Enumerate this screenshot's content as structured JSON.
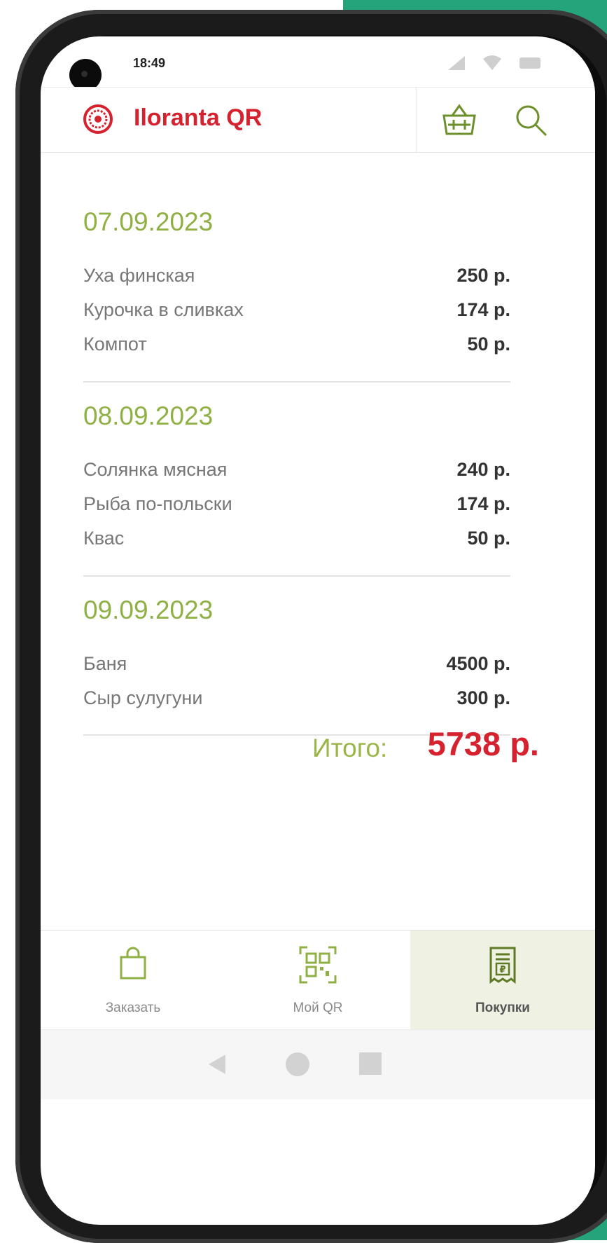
{
  "status_bar": {
    "time": "18:49"
  },
  "app_bar": {
    "title": "Iloranta QR"
  },
  "purchases": [
    {
      "date": "07.09.2023",
      "items": [
        {
          "name": "Уха финская",
          "price": "250 р."
        },
        {
          "name": "Курочка в сливках",
          "price": "174 р."
        },
        {
          "name": "Компот",
          "price": "50 р."
        }
      ]
    },
    {
      "date": "08.09.2023",
      "items": [
        {
          "name": "Солянка мясная",
          "price": "240 р."
        },
        {
          "name": "Рыба по-польски",
          "price": "174 р."
        },
        {
          "name": "Квас",
          "price": "50 р."
        }
      ]
    },
    {
      "date": "09.09.2023",
      "items": [
        {
          "name": "Баня",
          "price": "4500 р."
        },
        {
          "name": "Сыр сулугуни",
          "price": "300 р."
        }
      ]
    }
  ],
  "total": {
    "label": "Итого:",
    "value": "5738 р."
  },
  "bottom_nav": [
    {
      "label": "Заказать",
      "icon": "shopping-bag-icon"
    },
    {
      "label": "Мой QR",
      "icon": "qr-code-icon"
    },
    {
      "label": "Покупки",
      "icon": "receipt-icon",
      "active": true
    }
  ],
  "colors": {
    "accent_green": "#8fb044",
    "brand_red": "#d6222f",
    "frame_green": "#25a37a"
  }
}
